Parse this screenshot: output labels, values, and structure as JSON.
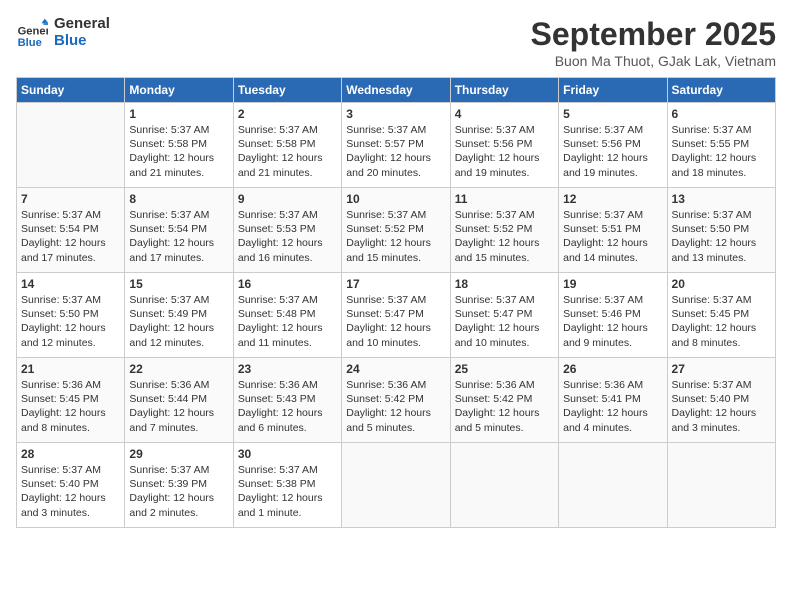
{
  "logo": {
    "line1": "General",
    "line2": "Blue"
  },
  "title": "September 2025",
  "subtitle": "Buon Ma Thuot, GJak Lak, Vietnam",
  "days_header": [
    "Sunday",
    "Monday",
    "Tuesday",
    "Wednesday",
    "Thursday",
    "Friday",
    "Saturday"
  ],
  "weeks": [
    [
      {
        "day": "",
        "info": ""
      },
      {
        "day": "1",
        "info": "Sunrise: 5:37 AM\nSunset: 5:58 PM\nDaylight: 12 hours\nand 21 minutes."
      },
      {
        "day": "2",
        "info": "Sunrise: 5:37 AM\nSunset: 5:58 PM\nDaylight: 12 hours\nand 21 minutes."
      },
      {
        "day": "3",
        "info": "Sunrise: 5:37 AM\nSunset: 5:57 PM\nDaylight: 12 hours\nand 20 minutes."
      },
      {
        "day": "4",
        "info": "Sunrise: 5:37 AM\nSunset: 5:56 PM\nDaylight: 12 hours\nand 19 minutes."
      },
      {
        "day": "5",
        "info": "Sunrise: 5:37 AM\nSunset: 5:56 PM\nDaylight: 12 hours\nand 19 minutes."
      },
      {
        "day": "6",
        "info": "Sunrise: 5:37 AM\nSunset: 5:55 PM\nDaylight: 12 hours\nand 18 minutes."
      }
    ],
    [
      {
        "day": "7",
        "info": "Sunrise: 5:37 AM\nSunset: 5:54 PM\nDaylight: 12 hours\nand 17 minutes."
      },
      {
        "day": "8",
        "info": "Sunrise: 5:37 AM\nSunset: 5:54 PM\nDaylight: 12 hours\nand 17 minutes."
      },
      {
        "day": "9",
        "info": "Sunrise: 5:37 AM\nSunset: 5:53 PM\nDaylight: 12 hours\nand 16 minutes."
      },
      {
        "day": "10",
        "info": "Sunrise: 5:37 AM\nSunset: 5:52 PM\nDaylight: 12 hours\nand 15 minutes."
      },
      {
        "day": "11",
        "info": "Sunrise: 5:37 AM\nSunset: 5:52 PM\nDaylight: 12 hours\nand 15 minutes."
      },
      {
        "day": "12",
        "info": "Sunrise: 5:37 AM\nSunset: 5:51 PM\nDaylight: 12 hours\nand 14 minutes."
      },
      {
        "day": "13",
        "info": "Sunrise: 5:37 AM\nSunset: 5:50 PM\nDaylight: 12 hours\nand 13 minutes."
      }
    ],
    [
      {
        "day": "14",
        "info": "Sunrise: 5:37 AM\nSunset: 5:50 PM\nDaylight: 12 hours\nand 12 minutes."
      },
      {
        "day": "15",
        "info": "Sunrise: 5:37 AM\nSunset: 5:49 PM\nDaylight: 12 hours\nand 12 minutes."
      },
      {
        "day": "16",
        "info": "Sunrise: 5:37 AM\nSunset: 5:48 PM\nDaylight: 12 hours\nand 11 minutes."
      },
      {
        "day": "17",
        "info": "Sunrise: 5:37 AM\nSunset: 5:47 PM\nDaylight: 12 hours\nand 10 minutes."
      },
      {
        "day": "18",
        "info": "Sunrise: 5:37 AM\nSunset: 5:47 PM\nDaylight: 12 hours\nand 10 minutes."
      },
      {
        "day": "19",
        "info": "Sunrise: 5:37 AM\nSunset: 5:46 PM\nDaylight: 12 hours\nand 9 minutes."
      },
      {
        "day": "20",
        "info": "Sunrise: 5:37 AM\nSunset: 5:45 PM\nDaylight: 12 hours\nand 8 minutes."
      }
    ],
    [
      {
        "day": "21",
        "info": "Sunrise: 5:36 AM\nSunset: 5:45 PM\nDaylight: 12 hours\nand 8 minutes."
      },
      {
        "day": "22",
        "info": "Sunrise: 5:36 AM\nSunset: 5:44 PM\nDaylight: 12 hours\nand 7 minutes."
      },
      {
        "day": "23",
        "info": "Sunrise: 5:36 AM\nSunset: 5:43 PM\nDaylight: 12 hours\nand 6 minutes."
      },
      {
        "day": "24",
        "info": "Sunrise: 5:36 AM\nSunset: 5:42 PM\nDaylight: 12 hours\nand 5 minutes."
      },
      {
        "day": "25",
        "info": "Sunrise: 5:36 AM\nSunset: 5:42 PM\nDaylight: 12 hours\nand 5 minutes."
      },
      {
        "day": "26",
        "info": "Sunrise: 5:36 AM\nSunset: 5:41 PM\nDaylight: 12 hours\nand 4 minutes."
      },
      {
        "day": "27",
        "info": "Sunrise: 5:37 AM\nSunset: 5:40 PM\nDaylight: 12 hours\nand 3 minutes."
      }
    ],
    [
      {
        "day": "28",
        "info": "Sunrise: 5:37 AM\nSunset: 5:40 PM\nDaylight: 12 hours\nand 3 minutes."
      },
      {
        "day": "29",
        "info": "Sunrise: 5:37 AM\nSunset: 5:39 PM\nDaylight: 12 hours\nand 2 minutes."
      },
      {
        "day": "30",
        "info": "Sunrise: 5:37 AM\nSunset: 5:38 PM\nDaylight: 12 hours\nand 1 minute."
      },
      {
        "day": "",
        "info": ""
      },
      {
        "day": "",
        "info": ""
      },
      {
        "day": "",
        "info": ""
      },
      {
        "day": "",
        "info": ""
      }
    ]
  ]
}
